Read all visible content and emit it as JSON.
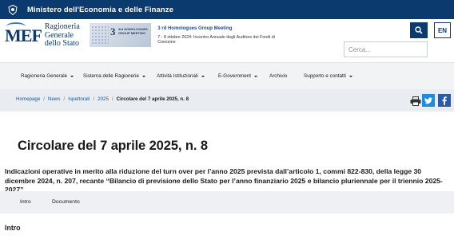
{
  "topbar": {
    "ministry": "Ministero dell'Economia e delle Finanze"
  },
  "logo": {
    "mef": "MEF",
    "line1": "Ragioneria",
    "line2": "Generale",
    "line3": "dello Stato"
  },
  "banner": {
    "image_number": "3",
    "image_text": "3rd HOMOLOGUES GROUP MEETING",
    "title": "3 rd Homologues Group Meeting",
    "subtitle": "7 - 8 ottobre 2024: Incontro Annuale degli Auditors dei Fondi di Coesione"
  },
  "search": {
    "placeholder": "Cerca..."
  },
  "language": {
    "label": "EN"
  },
  "nav": {
    "items": [
      {
        "label": "Ragioneria Generale",
        "dropdown": true
      },
      {
        "label": "Sistema delle Ragionerie",
        "dropdown": true
      },
      {
        "label": "Attività Istituzionali",
        "dropdown": true
      },
      {
        "label": "E-Government",
        "dropdown": true
      },
      {
        "label": "Archivio",
        "dropdown": false
      },
      {
        "label": "Supporto e contatti",
        "dropdown": true
      }
    ]
  },
  "breadcrumb": {
    "items": [
      "Homepage",
      "News",
      "Ispettorati",
      "2025"
    ],
    "current": "Circolare del 7 aprile 2025, n. 8",
    "separator": "/"
  },
  "share": {
    "print_icon": "print-icon",
    "twitter_icon": "twitter-icon",
    "facebook_icon": "facebook-icon"
  },
  "page": {
    "title": "Circolare del 7 aprile 2025, n. 8",
    "description": "Indicazioni operative in merito alla riduzione del turn over per l’anno 2025 prevista dall’articolo 1, commi 822-830, della legge 30 dicembre 2024, n. 207, recante “Bilancio di previsione dello Stato per l’anno finanziario 2025 e bilancio pluriennale per il triennio 2025-2027”"
  },
  "tabs": [
    {
      "label": "Intro"
    },
    {
      "label": "Documento"
    }
  ],
  "section": {
    "heading": "Intro"
  },
  "colors": {
    "primary": "#0b3a6e",
    "twitter": "#1b8be0",
    "facebook": "#2a5aa8",
    "link": "#0b5ea8"
  }
}
